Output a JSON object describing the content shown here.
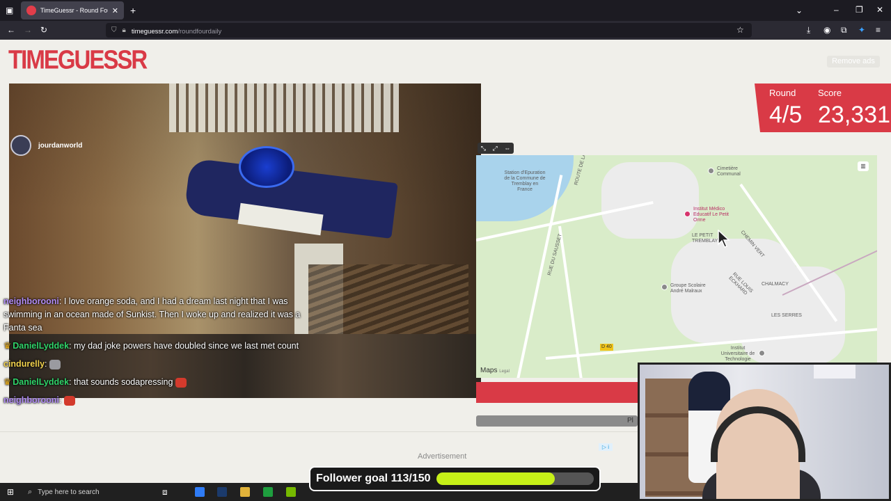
{
  "browser": {
    "tab_title": "TimeGuessr - Round Four",
    "url_host": "timeguessr.com",
    "url_path": "/roundfourdaily"
  },
  "site": {
    "logo_text": "TIMEGUESSR",
    "remove_ads_label": "Remove ads"
  },
  "photo": {
    "streamer_name": "jourdanworld"
  },
  "chat": [
    {
      "user": "neighborooni",
      "message": " I love orange soda, and I had a dream last night that I was swimming in an ocean made of Sunkist. Then I woke up and realized it was a Fanta sea",
      "crown": false
    },
    {
      "user": "DanielLyddek",
      "message": " my dad joke powers have doubled since we last met count",
      "crown": true
    },
    {
      "user": "cindurelly",
      "message": "",
      "crown": false
    },
    {
      "user": "DanielLyddek",
      "message": " that sounds sodapressing",
      "crown": true
    },
    {
      "user": "neighborooni",
      "message": "",
      "crown": false
    }
  ],
  "score": {
    "round_label": "Round",
    "score_label": "Score",
    "round_value": "4/5",
    "score_value": "23,331"
  },
  "map": {
    "brand": "Maps",
    "legal": "Legal",
    "labels": {
      "station": "Station d'Epuration de la Commune de Tremblay en France",
      "cemetery": "Cimetière Communal",
      "institut": "Institut Médico Educatif Le Petit Orme",
      "petit_tremblay": "LE PETIT TREMBLAY",
      "chemin_vert": "CHEMIN VERT",
      "groupe_scolaire": "Groupe Scolaire André Malraux",
      "chalmacy": "CHALMACY",
      "les_serres": "LES SERRES",
      "institut_tech": "Institut Universitaire de Technologie",
      "rue_sausset": "RUE DU SAUSSET",
      "route": "ROUTE DE LA C",
      "rue_louis": "RUE LOUIS ECKHARD",
      "d40": "D 40"
    }
  },
  "guess_bar": {
    "place_text": "Pl"
  },
  "ads": {
    "label": "Advertisement"
  },
  "follower_goal": {
    "text": "Follower goal 113/150",
    "current": 113,
    "target": 150
  },
  "taskbar": {
    "search_placeholder": "Type here to search"
  },
  "colors": {
    "accent": "#d93a46",
    "goal_fill": "#c6f018"
  }
}
